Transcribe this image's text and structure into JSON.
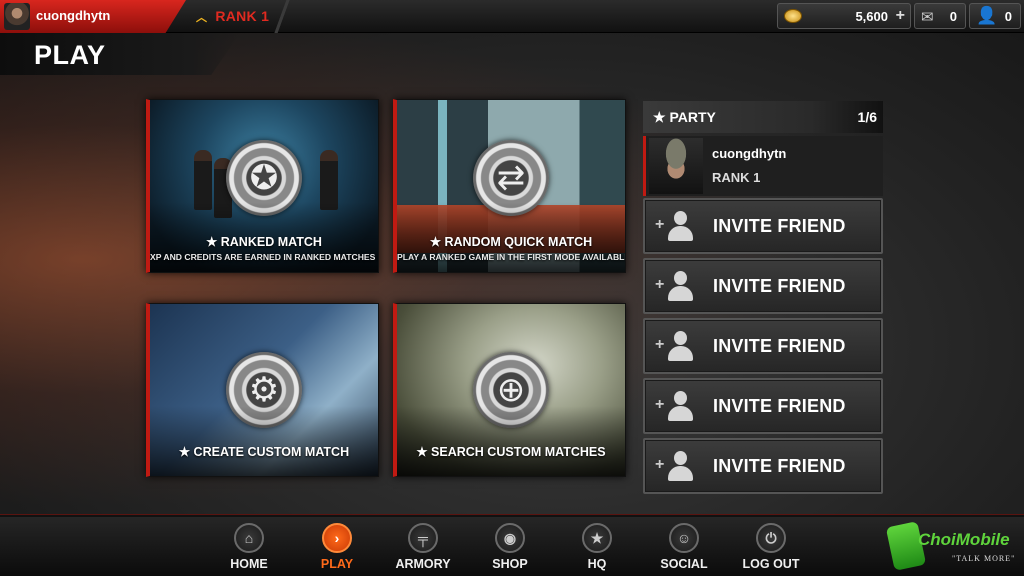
{
  "topbar": {
    "username": "cuongdhytn",
    "rank_label": "RANK 1",
    "credits": "5,600",
    "mail_count": "0",
    "friend_requests_count": "0"
  },
  "page": {
    "title": "PLAY"
  },
  "tiles": [
    {
      "title": "★ RANKED MATCH",
      "subtitle": "XP AND CREDITS ARE EARNED IN RANKED MATCHES ONLY."
    },
    {
      "title": "★ RANDOM QUICK MATCH",
      "subtitle": "PLAY A RANKED GAME IN THE FIRST MODE AVAILABLE"
    },
    {
      "title": "★ CREATE CUSTOM MATCH",
      "subtitle": ""
    },
    {
      "title": "★ SEARCH CUSTOM MATCHES",
      "subtitle": ""
    }
  ],
  "party": {
    "title": "★ PARTY",
    "count": "1/6",
    "member": {
      "name": "cuongdhytn",
      "rank": "RANK 1"
    },
    "invite_slots": [
      "INVITE FRIEND",
      "INVITE FRIEND",
      "INVITE FRIEND",
      "INVITE FRIEND",
      "INVITE FRIEND"
    ]
  },
  "bottom_nav": [
    {
      "label": "HOME",
      "icon": "home-icon",
      "active": false
    },
    {
      "label": "PLAY",
      "icon": "play-arrow-icon",
      "active": true
    },
    {
      "label": "ARMORY",
      "icon": "pistol-icon",
      "active": false
    },
    {
      "label": "SHOP",
      "icon": "shop-icon",
      "active": false
    },
    {
      "label": "HQ",
      "icon": "hq-star-icon",
      "active": false
    },
    {
      "label": "SOCIAL",
      "icon": "social-icon",
      "active": false
    },
    {
      "label": "LOG OUT",
      "icon": "power-icon",
      "active": false
    }
  ],
  "watermark": {
    "brand": "ChoiMobile",
    "tagline": "\"TALK MORE\""
  },
  "colors": {
    "accent_red": "#c01a12",
    "active_orange": "#ff6a1a",
    "rank_gold": "#f1b620"
  }
}
